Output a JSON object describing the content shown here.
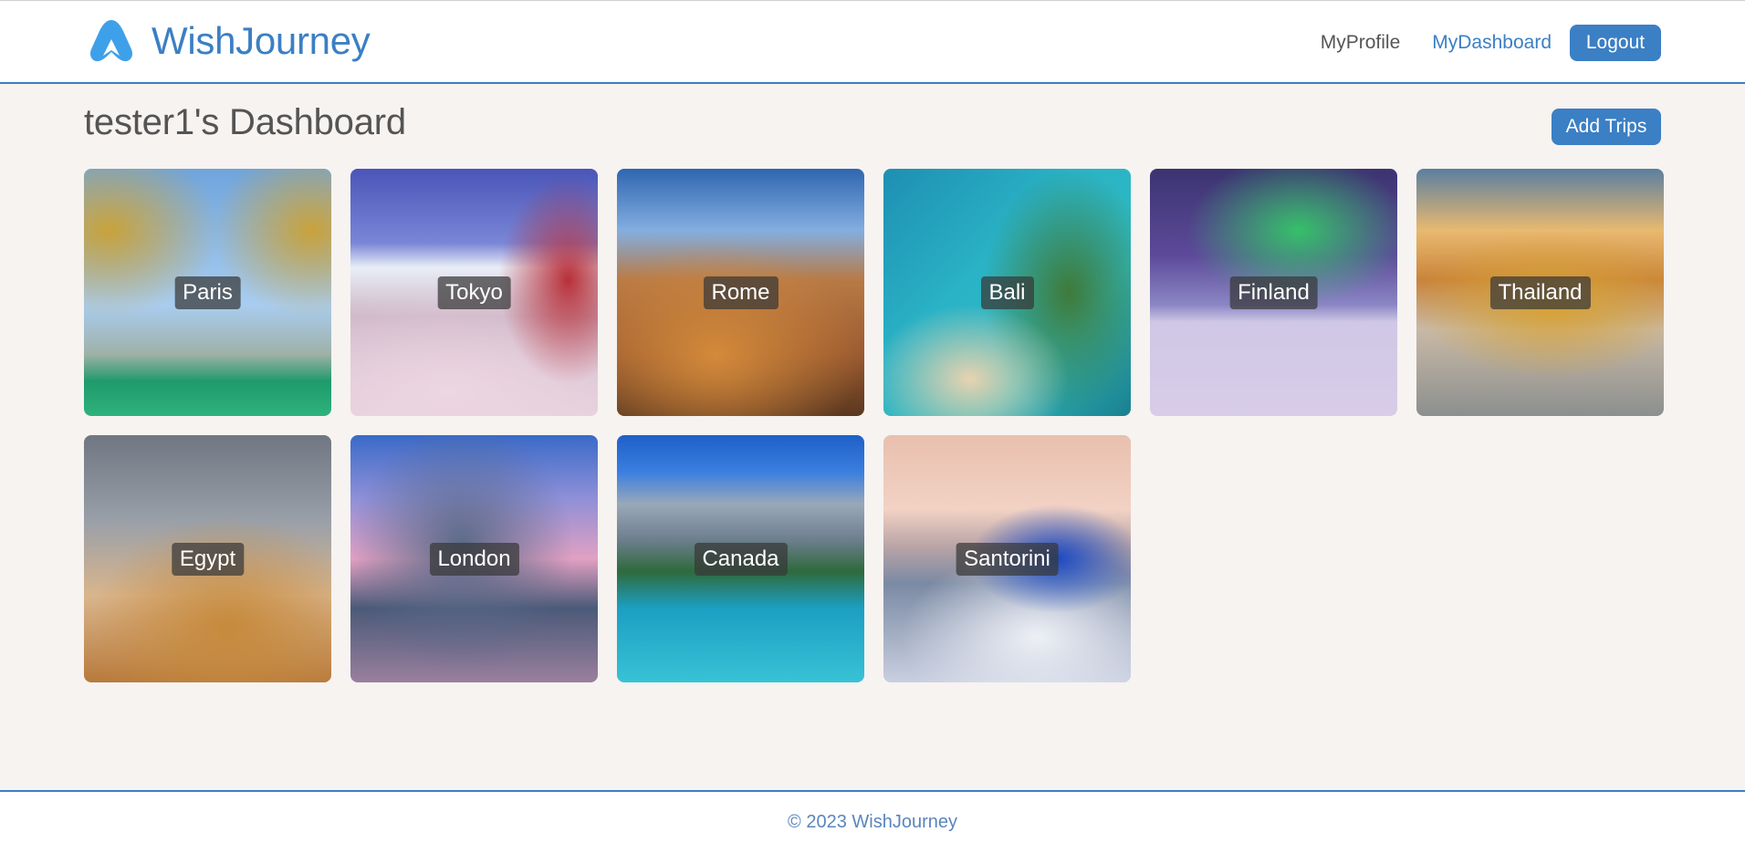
{
  "header": {
    "brand_name": "WishJourney",
    "brand_color": "#3b7fc4",
    "logo_icon": "plane-logo-icon",
    "nav": {
      "profile_label": "MyProfile",
      "dashboard_label": "MyDashboard",
      "logout_label": "Logout"
    }
  },
  "main": {
    "title": "tester1's Dashboard",
    "add_trips_label": "Add Trips",
    "trips": [
      {
        "label": "Paris"
      },
      {
        "label": "Tokyo"
      },
      {
        "label": "Rome"
      },
      {
        "label": "Bali"
      },
      {
        "label": "Finland"
      },
      {
        "label": "Thailand"
      },
      {
        "label": "Egypt"
      },
      {
        "label": "London"
      },
      {
        "label": "Canada"
      },
      {
        "label": "Santorini"
      }
    ]
  },
  "footer": {
    "copyright": "© 2023 WishJourney"
  }
}
